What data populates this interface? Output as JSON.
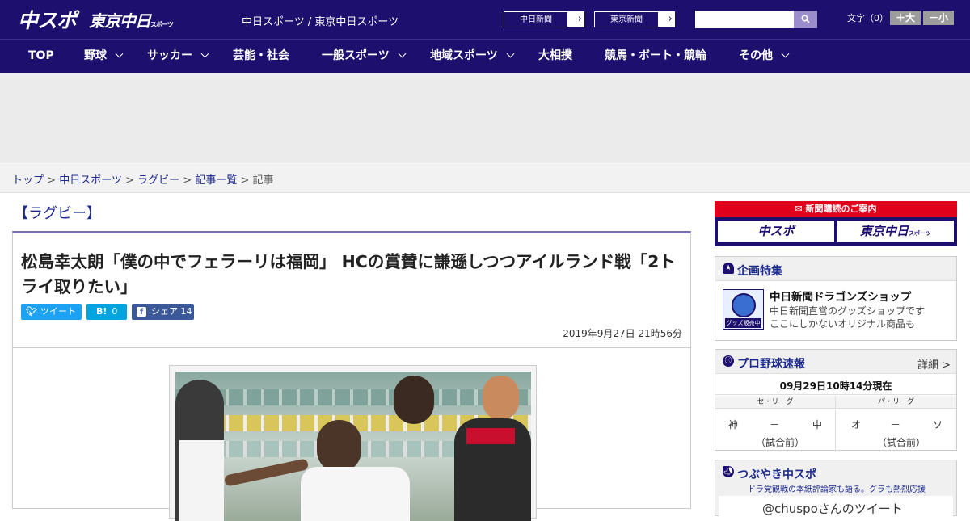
{
  "header": {
    "logo_chuspo": "中スポ",
    "logo_tokyo": "東京中日",
    "logo_tokyo_small": "スポーツ",
    "site_links": "中日スポーツ / 東京中日スポーツ",
    "ext_links": [
      {
        "label": "中日新聞"
      },
      {
        "label": "東京新聞"
      }
    ],
    "search_placeholder": "",
    "font_size_label": "文字（0）",
    "font_size_up": "＋大",
    "font_size_down": "－小"
  },
  "nav": {
    "items": [
      {
        "label": "TOP",
        "dropdown": false
      },
      {
        "label": "野球",
        "dropdown": true
      },
      {
        "label": "サッカー",
        "dropdown": true
      },
      {
        "label": "芸能・社会",
        "dropdown": false
      },
      {
        "label": "一般スポーツ",
        "dropdown": true
      },
      {
        "label": "地域スポーツ",
        "dropdown": true
      },
      {
        "label": "大相撲",
        "dropdown": false
      },
      {
        "label": "競馬・ボート・競輪",
        "dropdown": false
      },
      {
        "label": "その他",
        "dropdown": true
      }
    ]
  },
  "breadcrumb": {
    "items": [
      "トップ",
      "中日スポーツ",
      "ラグビー",
      "記事一覧"
    ],
    "current": "記事",
    "separator": ">"
  },
  "article": {
    "category": "【ラグビー】",
    "title": "松島幸太朗「僕の中でフェラーリは福岡」 HCの賞賛に謙遜しつつアイルランド戦「2トライ取りたい」",
    "share": {
      "tweet_label": "ツイート",
      "hatena_label": "B!",
      "hatena_count": "0",
      "facebook_label": "シェア",
      "facebook_count": "14"
    },
    "date": "2019年9月27日 21時56分"
  },
  "sidebar": {
    "subscription": {
      "heading": "新聞購読のご案内",
      "logo_left": "中スポ",
      "logo_right": "東京中日",
      "logo_right_small": "スポーツ"
    },
    "feature": {
      "heading": "企画特集",
      "shop_title": "中日新聞ドラゴンズショップ",
      "shop_desc1": "中日新聞直営のグッズショップです",
      "shop_desc2": "ここにしかないオリジナル商品も",
      "shop_tag": "グッズ販売中"
    },
    "baseball": {
      "heading": "プロ野球速報",
      "detail_link": "詳細 >",
      "time": "09月29日10時14分現在",
      "leagues": [
        "セ・リーグ",
        "パ・リーグ"
      ],
      "games": [
        {
          "home": "神",
          "score": "－",
          "away": "中",
          "status": "（試合前）"
        },
        {
          "home": "オ",
          "score": "－",
          "away": "ソ",
          "status": "（試合前）"
        }
      ]
    },
    "tweets": {
      "heading": "つぶやき中スポ",
      "sub": "ドラ党観戦の本紙評論家も語る。グラも熱烈応援",
      "user": "@chuspoさんのツイート"
    }
  },
  "colors": {
    "brand": "#1d0f6e",
    "accent": "#e0001b",
    "link": "#1d2b8c"
  }
}
